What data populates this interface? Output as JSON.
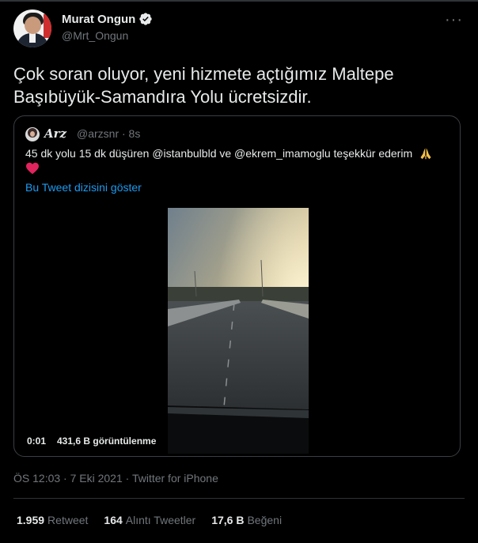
{
  "author": {
    "display_name": "Murat Ongun",
    "handle": "@Mrt_Ongun"
  },
  "tweet": {
    "text": "Çok soran oluyor, yeni hizmete açtığımız Maltepe Başıbüyük-Samandıra Yolu ücretsizdir."
  },
  "quoted": {
    "display_name": "𝑨𝒓𝒛",
    "handle_time": "@arzsnr · 8s",
    "text": "45 dk yolu 15 dk düşüren @istanbulbld ve @ekrem_imamoglu teşekkür ederim",
    "show_thread": "Bu Tweet dizisini göster",
    "video_time": "0:01",
    "video_views": "431,6 B görüntülenme"
  },
  "meta": {
    "timestamp": "ÖS 12:03 · 7 Eki 2021 · Twitter for iPhone"
  },
  "stats": [
    {
      "count": "1.959",
      "label": "Retweet"
    },
    {
      "count": "164",
      "label": "Alıntı Tweetler"
    },
    {
      "count": "17,6 B",
      "label": "Beğeni"
    }
  ],
  "colors": {
    "background": "#000000",
    "text": "#e7e9ea",
    "muted": "#71767b",
    "link": "#1d9bf0",
    "verified": "#e7e9ea",
    "heart": "#e0245e"
  },
  "icons": [
    "verified-badge-icon",
    "more-icon",
    "pray-icon",
    "heart-icon"
  ]
}
